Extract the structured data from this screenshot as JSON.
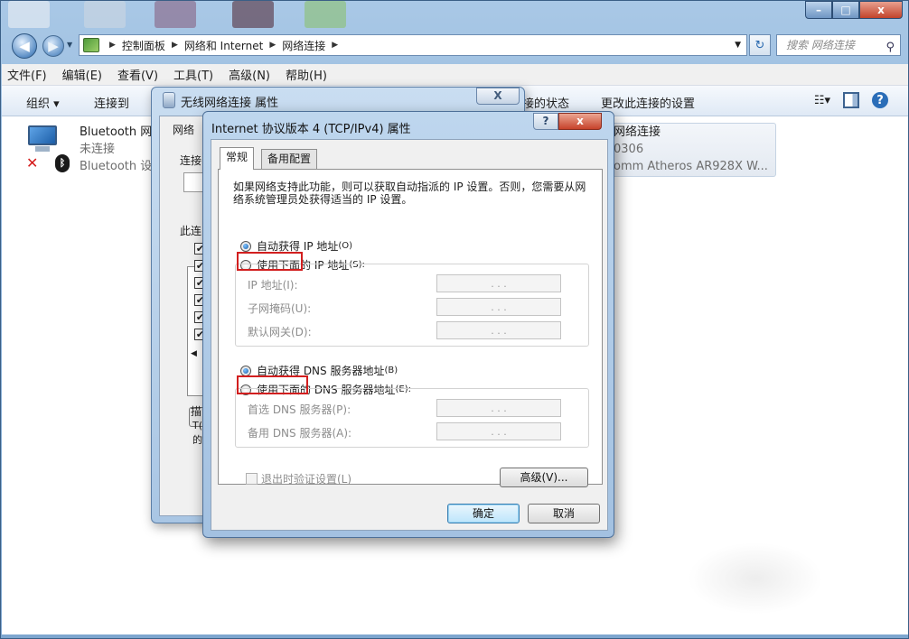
{
  "window": {
    "controls": {
      "minimize": "–",
      "maximize": "□",
      "close": "x"
    }
  },
  "address": {
    "crumbs": [
      "控制面板",
      "网络和 Internet",
      "网络连接"
    ],
    "search_placeholder": "搜索 网络连接"
  },
  "menu": [
    "文件(F)",
    "编辑(E)",
    "查看(V)",
    "工具(T)",
    "高级(N)",
    "帮助(H)"
  ],
  "toolbar": {
    "organize": "组织 ▾",
    "connect_to": "连接到",
    "status": "接的状态",
    "change_settings": "更改此连接的设置"
  },
  "connections": {
    "bluetooth": {
      "name": "Bluetooth 网",
      "status": "未连接",
      "device": "Bluetooth 设"
    },
    "wireless": {
      "name": "网络连接",
      "status": "0306",
      "device": "omm Atheros AR928X W..."
    }
  },
  "back_dialog": {
    "title": "无线网络连接 属性",
    "tab": "网络",
    "connect_label": "连接",
    "this_conn_label": "此连",
    "desc_label": "描",
    "desc_frag1": "T(",
    "desc_frag2": "的"
  },
  "dialog": {
    "title": "Internet 协议版本 4 (TCP/IPv4) 属性",
    "help_btn": "?",
    "close_btn": "x",
    "tabs": [
      "常规",
      "备用配置"
    ],
    "description": "如果网络支持此功能，则可以获取自动指派的 IP 设置。否则，您需要从网络系统管理员处获得适当的 IP 设置。",
    "ip": {
      "auto_label": "自动获得 IP 地址",
      "auto_hotkey": "(O)",
      "manual_label": "使用下面的 IP 地址",
      "manual_hotkey": "(S):",
      "selected": "auto",
      "fields": [
        {
          "label": "IP 地址(I):",
          "value": ".   .   ."
        },
        {
          "label": "子网掩码(U):",
          "value": ".   .   ."
        },
        {
          "label": "默认网关(D):",
          "value": ".   .   ."
        }
      ]
    },
    "dns": {
      "auto_label": "自动获得 DNS 服务器地址",
      "auto_hotkey": "(B)",
      "manual_label": "使用下面的 DNS 服务器地址",
      "manual_hotkey": "(E):",
      "selected": "auto",
      "fields": [
        {
          "label": "首选 DNS 服务器(P):",
          "value": ".   .   ."
        },
        {
          "label": "备用 DNS 服务器(A):",
          "value": ".   .   ."
        }
      ]
    },
    "validate_label": "退出时验证设置(L)",
    "advanced_btn": "高级(V)...",
    "ok_btn": "确定",
    "cancel_btn": "取消"
  },
  "colors": {
    "highlight": "#d21f1f",
    "title_bar": "#a9c8e6"
  }
}
